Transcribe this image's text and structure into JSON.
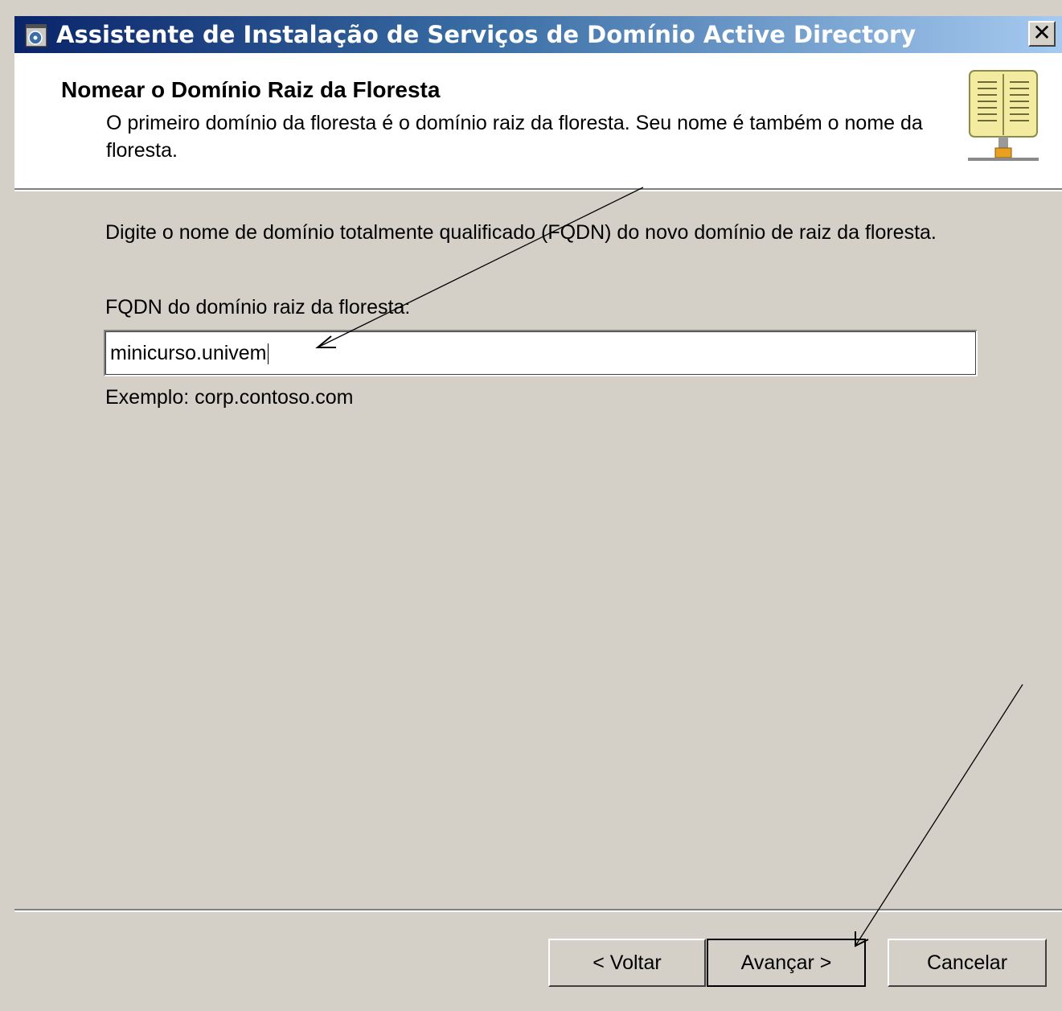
{
  "window": {
    "title": "Assistente de Instalação de Serviços de Domínio Active Directory",
    "close_label": "✕"
  },
  "header": {
    "title": "Nomear o Domínio Raiz da Floresta",
    "subtitle": "O primeiro domínio da floresta é o domínio raiz da floresta. Seu nome é também o nome da floresta."
  },
  "body": {
    "prompt": "Digite o nome de domínio totalmente qualificado (FQDN) do novo domínio de raiz da floresta.",
    "field_label": "FQDN do domínio raiz da floresta:",
    "field_value": "minicurso.univem",
    "example": "Exemplo: corp.contoso.com"
  },
  "buttons": {
    "back": "< Voltar",
    "next": "Avançar >",
    "cancel": "Cancelar"
  },
  "colors": {
    "titlebar_start": "#0a246a",
    "titlebar_end": "#a6caf0",
    "dialog_bg": "#d4d0c8",
    "header_bg": "#ffffff"
  }
}
